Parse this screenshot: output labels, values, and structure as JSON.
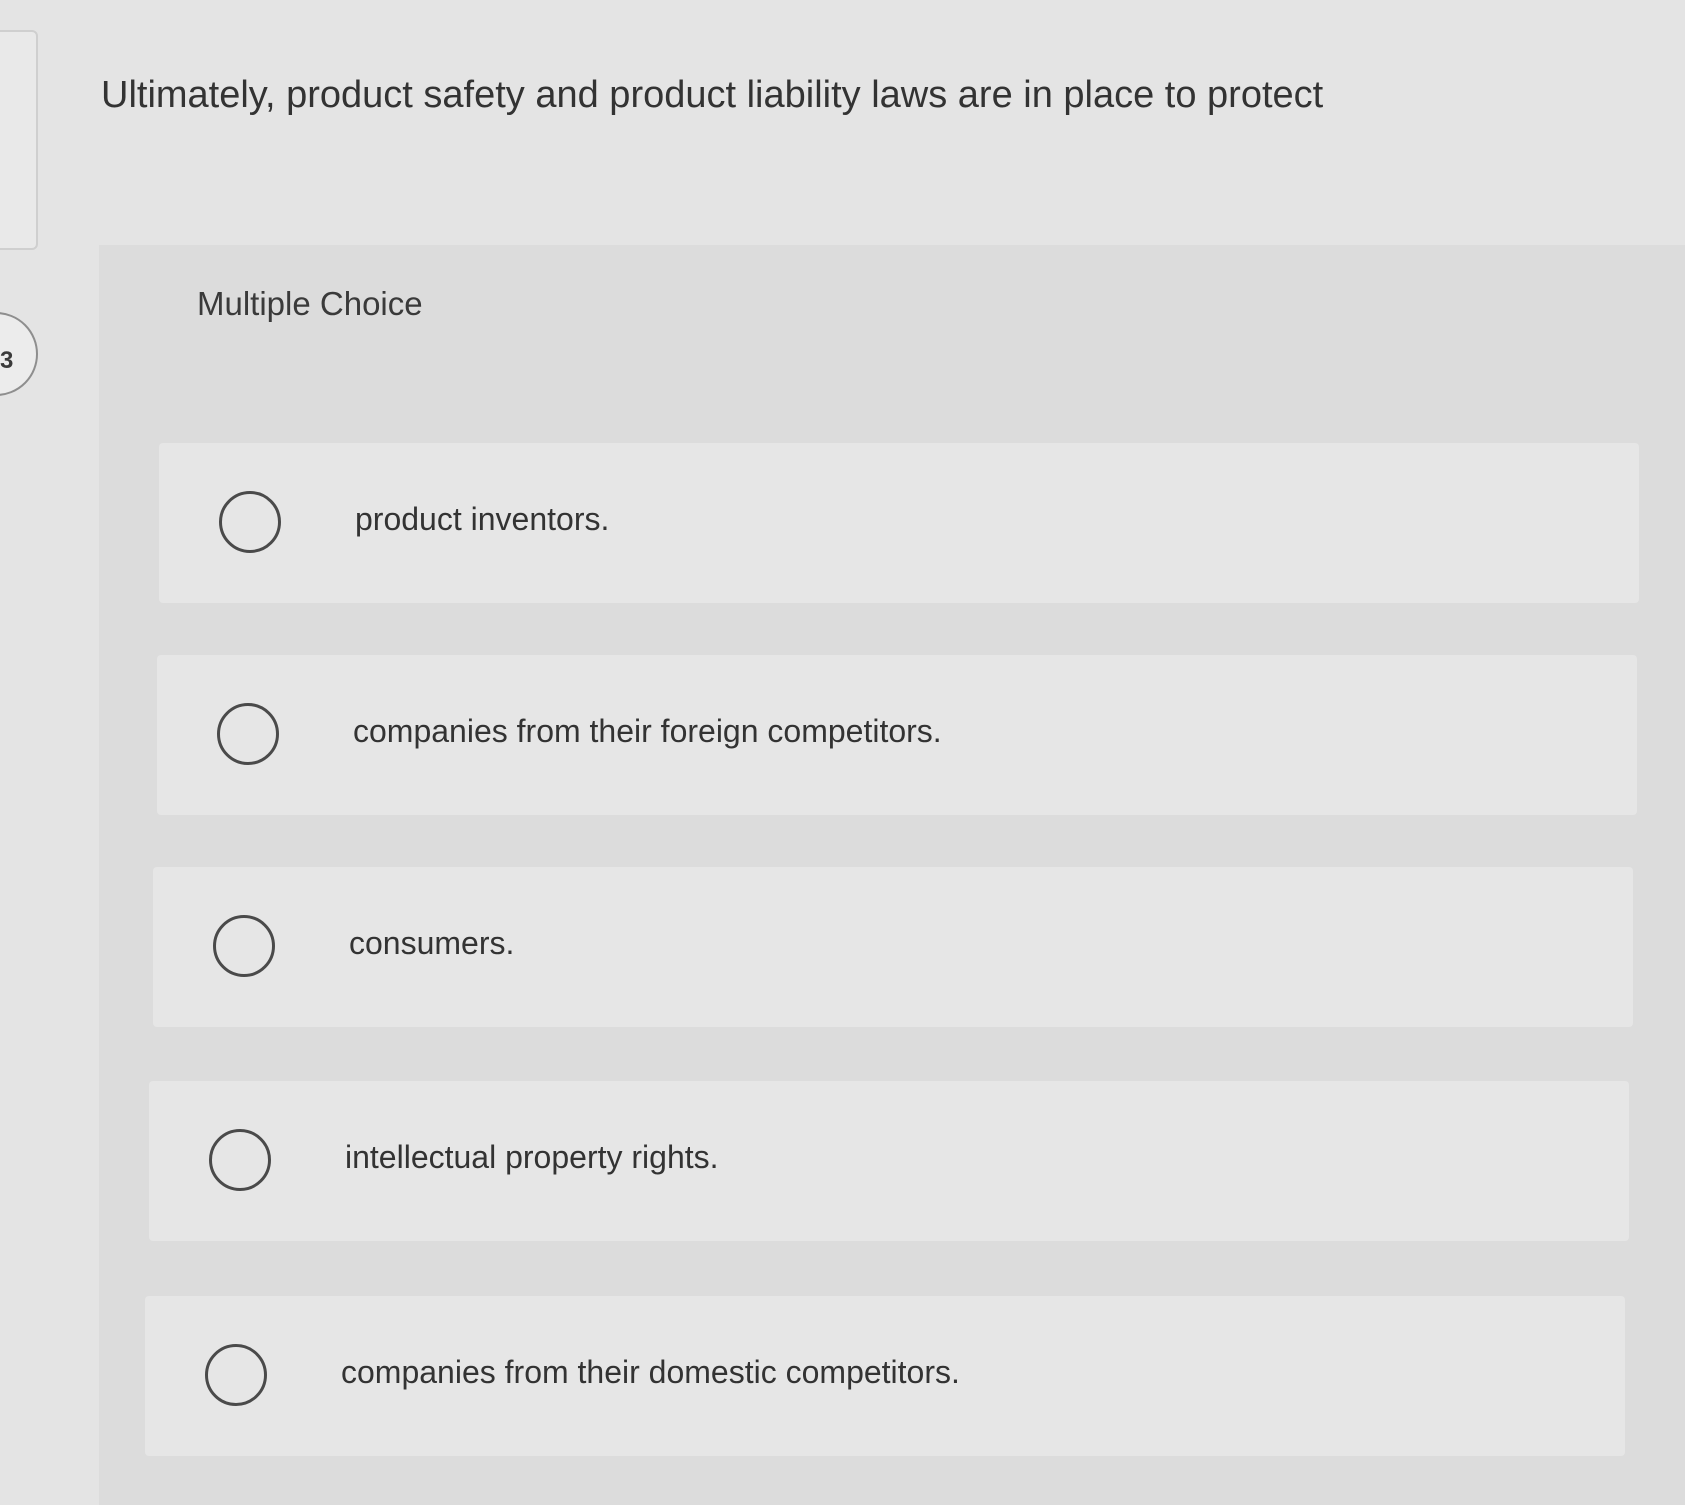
{
  "question": {
    "number": "3",
    "text": "Ultimately, product safety and product liability laws are in place to protect"
  },
  "multiple_choice": {
    "label": "Multiple Choice",
    "options": [
      {
        "label": "product inventors.",
        "selected": false
      },
      {
        "label": "companies from their foreign competitors.",
        "selected": false
      },
      {
        "label": "consumers.",
        "selected": false
      },
      {
        "label": "intellectual property rights.",
        "selected": false
      },
      {
        "label": "companies from their domestic competitors.",
        "selected": false
      }
    ]
  }
}
